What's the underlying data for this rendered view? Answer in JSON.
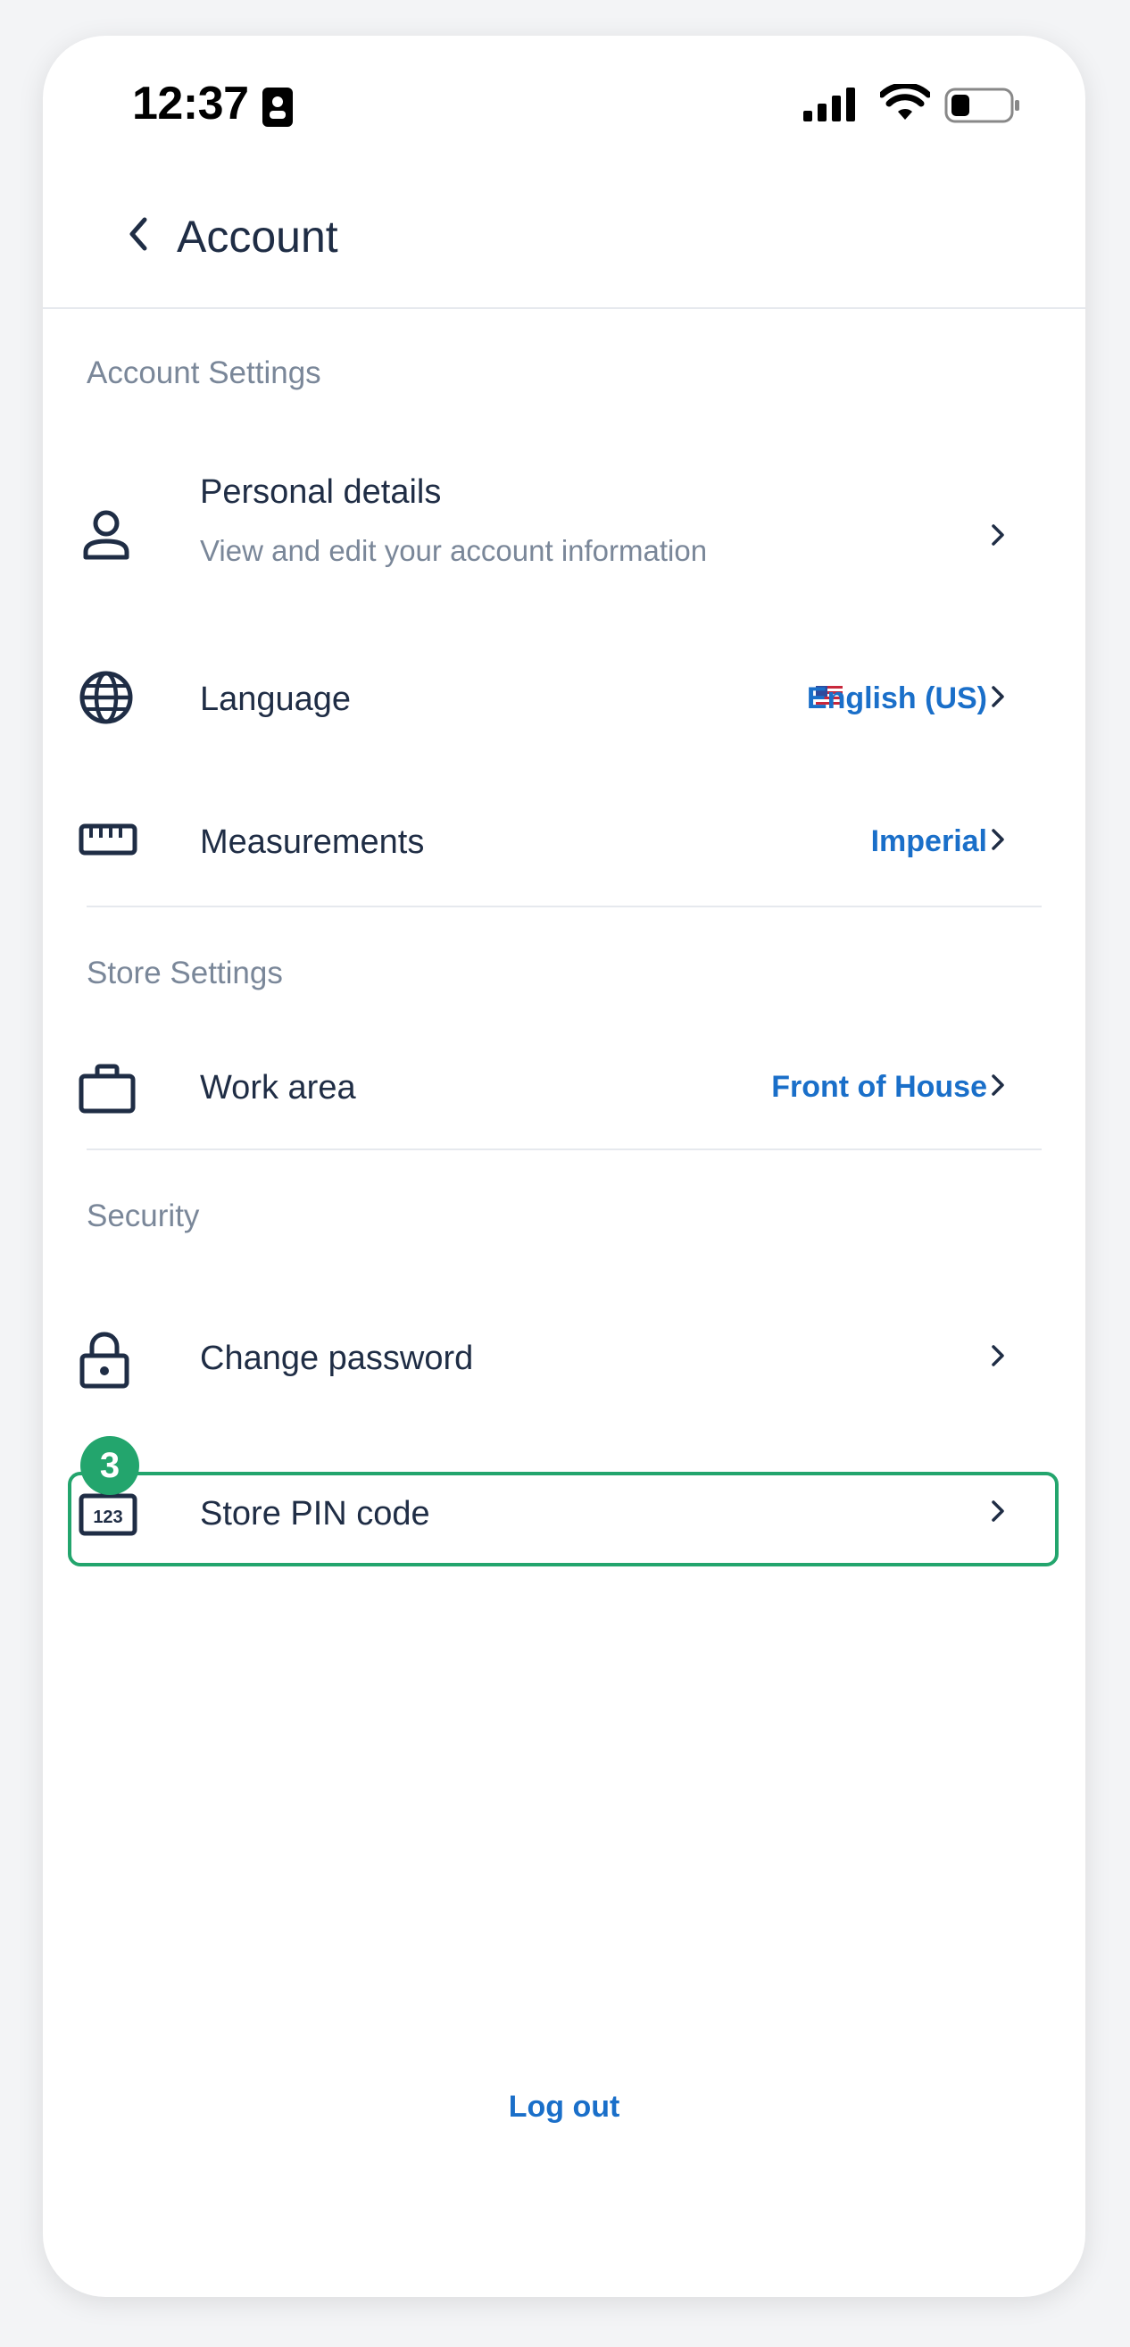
{
  "status_bar": {
    "time": "12:37"
  },
  "header": {
    "title": "Account"
  },
  "sections": {
    "account_settings": {
      "title": "Account Settings",
      "personal_details": {
        "label": "Personal details",
        "subtitle": "View and edit your account information"
      },
      "language": {
        "label": "Language",
        "value": "English (US)"
      },
      "measurements": {
        "label": "Measurements",
        "value": "Imperial"
      }
    },
    "store_settings": {
      "title": "Store Settings",
      "work_area": {
        "label": "Work area",
        "value": "Front of House"
      }
    },
    "security": {
      "title": "Security",
      "change_password": {
        "label": "Change password"
      },
      "store_pin": {
        "label": "Store PIN code",
        "icon_text": "123"
      }
    }
  },
  "step_badge": "3",
  "logout": {
    "label": "Log out"
  },
  "colors": {
    "accent": "#1a6fc9",
    "highlight": "#23a56d",
    "text": "#1f2d45",
    "muted": "#7a8799"
  },
  "icons": [
    "contact-card-icon",
    "signal-icon",
    "wifi-icon",
    "battery-icon",
    "back-chevron-icon",
    "person-icon",
    "globe-icon",
    "ruler-icon",
    "briefcase-icon",
    "lock-icon",
    "pin-code-icon",
    "chevron-right-icon",
    "us-flag-icon"
  ]
}
